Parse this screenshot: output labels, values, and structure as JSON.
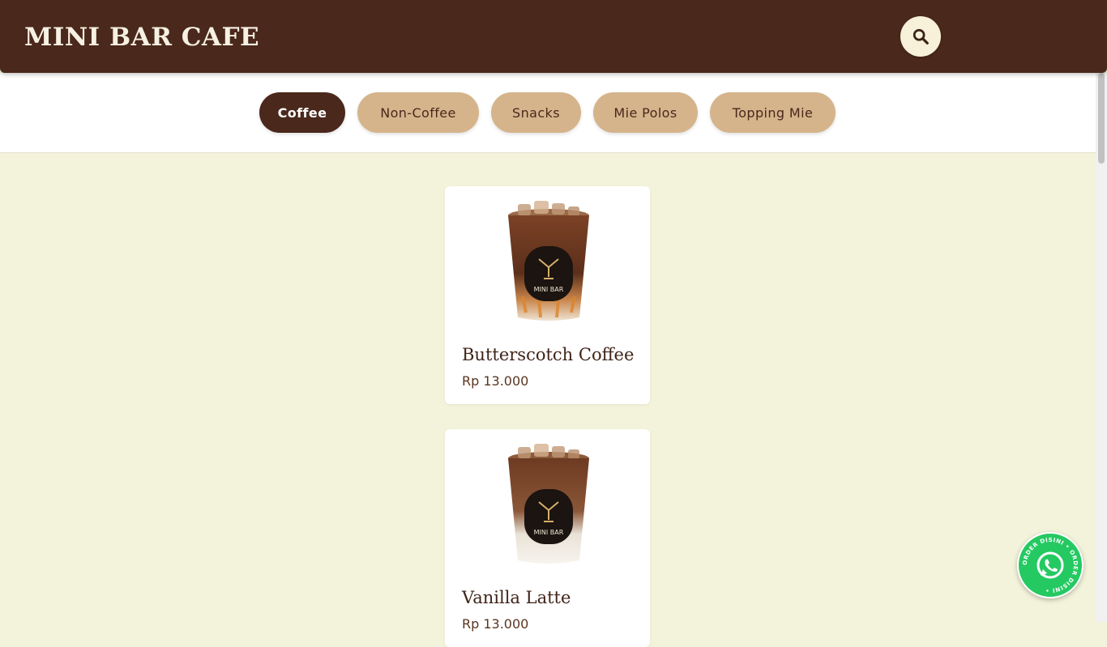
{
  "header": {
    "brand": "MINI BAR CAFE",
    "search_icon": "search-icon"
  },
  "categories": [
    {
      "label": "Coffee",
      "active": true
    },
    {
      "label": "Non-Coffee",
      "active": false
    },
    {
      "label": "Snacks",
      "active": false
    },
    {
      "label": "Mie Polos",
      "active": false
    },
    {
      "label": "Topping Mie",
      "active": false
    }
  ],
  "products": [
    {
      "name": "Butterscotch Coffee",
      "price": "Rp 13.000",
      "image_icon": "iced-coffee-cup-image"
    },
    {
      "name": "Vanilla Latte",
      "price": "Rp 13.000",
      "image_icon": "iced-latte-cup-image"
    }
  ],
  "whatsapp": {
    "icon": "whatsapp-icon",
    "ring_text": "ORDER DISINI • ORDER DISINI •"
  },
  "colors": {
    "header_bg": "#4a281b",
    "page_bg": "#f3f2da",
    "pill_inactive": "#d5b48c",
    "pill_active": "#4a281b",
    "whatsapp_green": "#25c962"
  }
}
